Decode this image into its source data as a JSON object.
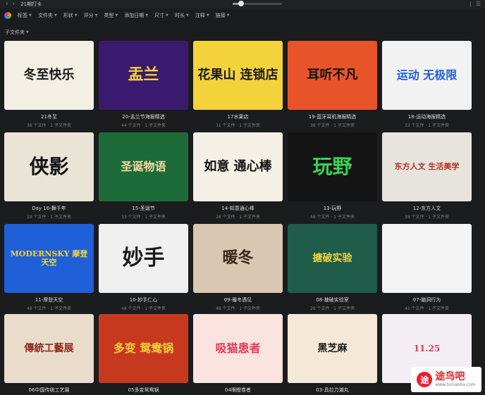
{
  "window": {
    "nav_back": "‹",
    "nav_forward": "›",
    "title": "21期打卡",
    "zoom_fraction": 0.17,
    "right_icons": [
      "|",
      "☰"
    ]
  },
  "filters": [
    {
      "label": "标签"
    },
    {
      "label": "文件夹"
    },
    {
      "label": "形状"
    },
    {
      "label": "评分"
    },
    {
      "label": "类型"
    },
    {
      "label": "添加日期"
    },
    {
      "label": "尺寸"
    },
    {
      "label": "时长"
    },
    {
      "label": "注释"
    },
    {
      "label": "链接"
    }
  ],
  "subfolder_label": "子文件夹",
  "cards": [
    {
      "name": "21冬至",
      "meta": "38 个文件 · 1 子文件夹",
      "bg": "#f3efe4",
      "fg": "#1a1a1a",
      "art": "冬至快乐",
      "size": 18
    },
    {
      "name": "20-孟兰节海报精选",
      "meta": "44 个文件 · 1 子文件夹",
      "bg": "#3a1a6e",
      "fg": "#f2d33a",
      "art": "盂兰",
      "size": 22
    },
    {
      "name": "17水果店",
      "meta": "31 个文件 · 1 子文件夹",
      "bg": "#f3d23b",
      "fg": "#1a1a1a",
      "art": "花果山 连锁店",
      "size": 18
    },
    {
      "name": "19-蓝牙耳机海报精选",
      "meta": "38 个文件 · 1 子文件夹",
      "bg": "#e8542a",
      "fg": "#111111",
      "art": "耳听不凡",
      "size": 18
    },
    {
      "name": "18-运动海报精选",
      "meta": "33 个文件 · 1 子文件夹",
      "bg": "#f2f2f2",
      "fg": "#1d5fe0",
      "art": "运动 无极限",
      "size": 16
    },
    {
      "name": "Day 16-舞千年",
      "meta": "19 个文件 · 1 子文件夹",
      "bg": "#eae4d6",
      "fg": "#111111",
      "art": "侠影",
      "size": 28
    },
    {
      "name": "15-圣诞节",
      "meta": "33 个文件 · 1 子文件夹",
      "bg": "#1e6b3a",
      "fg": "#f5d9a0",
      "art": "圣诞物语",
      "size": 16
    },
    {
      "name": "14-知意通心棒",
      "meta": "28 个文件 · 1 子文件夹",
      "bg": "#f4f0e6",
      "fg": "#111111",
      "art": "如意 通心棒",
      "size": 18
    },
    {
      "name": "13-玩野",
      "meta": "48 个文件 · 1 子文件夹",
      "bg": "#141414",
      "fg": "#39d353",
      "art": "玩野",
      "size": 28
    },
    {
      "name": "12-东方人文",
      "meta": "38 个文件 · 1 子文件夹",
      "bg": "#e7e3dd",
      "fg": "#b0331f",
      "art": "东方人文 生活美学",
      "size": 11
    },
    {
      "name": "11-摩登天空",
      "meta": "48 个文件 · 1 子文件夹",
      "bg": "#1f5fd8",
      "fg": "#f5d23b",
      "art": "MODERNSKY 摩登天空",
      "size": 11
    },
    {
      "name": "10-妙手仁心",
      "meta": "48 个文件 · 1 子文件夹",
      "bg": "#f0f0f0",
      "fg": "#1a1a1a",
      "art": "妙手",
      "size": 30
    },
    {
      "name": "09-暖冬遇见",
      "meta": "48 个文件 · 1 子文件夹",
      "bg": "#d9c7b2",
      "fg": "#3a2618",
      "art": "暖冬",
      "size": 22
    },
    {
      "name": "08-搪破实验室",
      "meta": "28 个文件 · 1 子文件夹",
      "bg": "#1f5c4a",
      "fg": "#f2d33a",
      "art": "搪破实验",
      "size": 14
    },
    {
      "name": "07-脑洞行为",
      "meta": "41 个文件 · 1 子文件夹",
      "bg": "#f4f4f4",
      "fg": "#cccccc",
      "art": "",
      "size": 14
    },
    {
      "name": "06中国传统工艺展",
      "meta": "",
      "bg": "#e9dccb",
      "fg": "#8e2a1f",
      "art": "傳統工藝展",
      "size": 14
    },
    {
      "name": "05多变鸳鸯锅",
      "meta": "",
      "bg": "#c7391f",
      "fg": "#f5d23b",
      "art": "多变 鸳鸯锅",
      "size": 16
    },
    {
      "name": "04眼瞪卷者",
      "meta": "",
      "bg": "#fbe4df",
      "fg": "#e23a5a",
      "art": "吸猫患者",
      "size": 16
    },
    {
      "name": "03-具拉力潮丸",
      "meta": "",
      "bg": "#f3e9d6",
      "fg": "#1a1a1a",
      "art": "黑芝麻",
      "size": 14
    },
    {
      "name": "",
      "meta": "",
      "bg": "#f2eef4",
      "fg": "#e23a5a",
      "art": "11.25",
      "size": 12
    }
  ],
  "watermark": {
    "text": "途鸟吧",
    "sub": "www.tuniaoba.com"
  }
}
